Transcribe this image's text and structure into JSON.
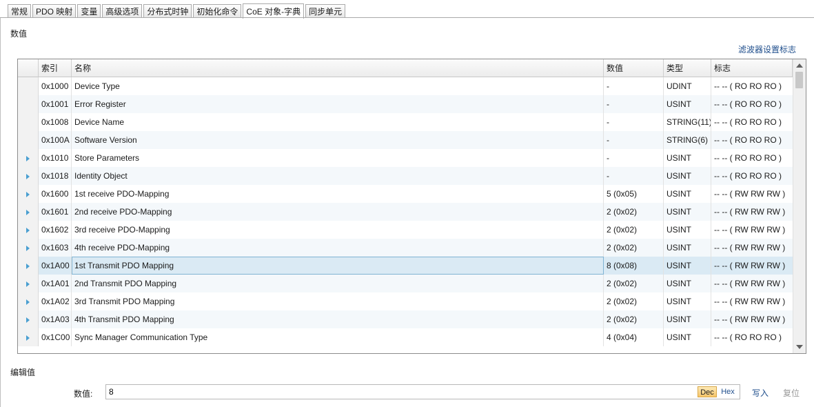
{
  "tabs": [
    {
      "label": "常规",
      "active": false
    },
    {
      "label": "PDO 映射",
      "active": false
    },
    {
      "label": "变量",
      "active": false
    },
    {
      "label": "高级选项",
      "active": false
    },
    {
      "label": "分布式时钟",
      "active": false
    },
    {
      "label": "初始化命令",
      "active": false
    },
    {
      "label": "CoE 对象-字典",
      "active": true
    },
    {
      "label": "同步单元",
      "active": false
    }
  ],
  "section_values_title": "数值",
  "filter_link": "滤波器设置标志",
  "table": {
    "headers": {
      "index": "索引",
      "name": "名称",
      "value": "数值",
      "type": "类型",
      "flags": "标志"
    },
    "rows": [
      {
        "expandable": false,
        "index": "0x1000",
        "name": "Device Type",
        "value": "-",
        "type": "UDINT",
        "flags": "-- -- ( RO RO RO )"
      },
      {
        "expandable": false,
        "index": "0x1001",
        "name": "Error Register",
        "value": "-",
        "type": "USINT",
        "flags": "-- -- ( RO RO RO )"
      },
      {
        "expandable": false,
        "index": "0x1008",
        "name": "Device Name",
        "value": "-",
        "type": "STRING(11)",
        "flags": "-- -- ( RO RO RO )"
      },
      {
        "expandable": false,
        "index": "0x100A",
        "name": "Software Version",
        "value": "-",
        "type": "STRING(6)",
        "flags": "-- -- ( RO RO RO )"
      },
      {
        "expandable": true,
        "index": "0x1010",
        "name": "Store Parameters",
        "value": "-",
        "type": "USINT",
        "flags": "-- -- ( RO RO RO )"
      },
      {
        "expandable": true,
        "index": "0x1018",
        "name": "Identity Object",
        "value": "-",
        "type": "USINT",
        "flags": "-- -- ( RO RO RO )"
      },
      {
        "expandable": true,
        "index": "0x1600",
        "name": "1st receive PDO-Mapping",
        "value": "5 (0x05)",
        "type": "USINT",
        "flags": "-- -- ( RW RW RW )"
      },
      {
        "expandable": true,
        "index": "0x1601",
        "name": "2nd receive PDO-Mapping",
        "value": "2 (0x02)",
        "type": "USINT",
        "flags": "-- -- ( RW RW RW )"
      },
      {
        "expandable": true,
        "index": "0x1602",
        "name": "3rd receive PDO-Mapping",
        "value": "2 (0x02)",
        "type": "USINT",
        "flags": "-- -- ( RW RW RW )"
      },
      {
        "expandable": true,
        "index": "0x1603",
        "name": "4th receive PDO-Mapping",
        "value": "2 (0x02)",
        "type": "USINT",
        "flags": "-- -- ( RW RW RW )"
      },
      {
        "expandable": true,
        "index": "0x1A00",
        "name": "1st Transmit PDO Mapping",
        "value": "8 (0x08)",
        "type": "USINT",
        "flags": "-- -- ( RW RW RW )",
        "selected": true
      },
      {
        "expandable": true,
        "index": "0x1A01",
        "name": "2nd Transmit PDO Mapping",
        "value": "2 (0x02)",
        "type": "USINT",
        "flags": "-- -- ( RW RW RW )"
      },
      {
        "expandable": true,
        "index": "0x1A02",
        "name": "3rd Transmit PDO Mapping",
        "value": "2 (0x02)",
        "type": "USINT",
        "flags": "-- -- ( RW RW RW )"
      },
      {
        "expandable": true,
        "index": "0x1A03",
        "name": "4th Transmit PDO Mapping",
        "value": "2 (0x02)",
        "type": "USINT",
        "flags": "-- -- ( RW RW RW )"
      },
      {
        "expandable": true,
        "index": "0x1C00",
        "name": "Sync Manager Communication Type",
        "value": "4 (0x04)",
        "type": "USINT",
        "flags": "-- -- ( RO RO RO )"
      }
    ]
  },
  "edit": {
    "section_title": "编辑值",
    "value_label": "数值:",
    "value_input": "8",
    "dec_label": "Dec",
    "hex_label": "Hex",
    "write_label": "写入",
    "reset_label": "复位"
  },
  "colors": {
    "accent_link": "#1f4e8c",
    "selected_row": "#daeaf4",
    "dec_active": "#f6c56a"
  }
}
